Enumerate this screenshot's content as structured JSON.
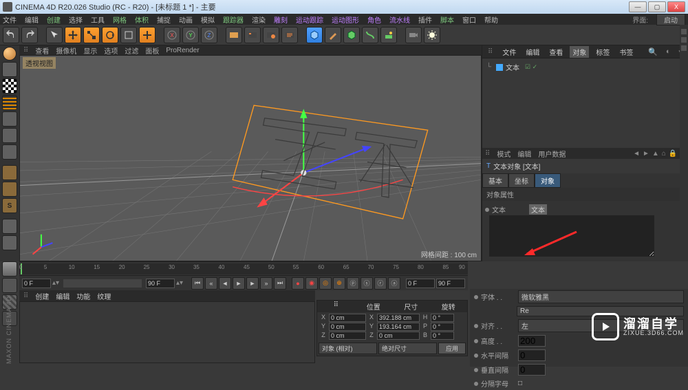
{
  "titlebar": {
    "title": "CINEMA 4D R20.026 Studio (RC - R20) - [未标题 1 *] - 主要"
  },
  "win": {
    "min": "—",
    "max": "▢",
    "close": "X"
  },
  "menu": {
    "items": [
      "文件",
      "编辑",
      "创建",
      "选择",
      "工具",
      "网格",
      "体积",
      "捕捉",
      "动画",
      "模拟",
      "跟踪器",
      "渲染",
      "雕刻",
      "运动跟踪",
      "运动图形",
      "角色",
      "流水线",
      "插件",
      "脚本",
      "窗口",
      "帮助"
    ],
    "layout_lbl": "界面:",
    "layout": "启动"
  },
  "vp_tabs": [
    "查看",
    "摄像机",
    "显示",
    "选项",
    "过滤",
    "面板",
    "ProRender"
  ],
  "viewport": {
    "label": "透视视图",
    "info": "网格间距 : 100 cm"
  },
  "objp": {
    "tabs": [
      "文件",
      "编辑",
      "查看",
      "对象",
      "标签",
      "书签"
    ],
    "item": "文本",
    "suffix": "☑ ✓"
  },
  "attr": {
    "tabs": [
      "模式",
      "编辑",
      "用户数据"
    ],
    "head": "文本对象 [文本]",
    "subtabs": [
      "基本",
      "坐标",
      "对象"
    ],
    "section": "对象属性",
    "text_lbl": "文本",
    "text_val": "文本",
    "font_lbl": "字体 . .",
    "font_val": "微软雅黑",
    "font_style": "Re",
    "align_lbl": "对齐 . .",
    "align_val": "左",
    "height_lbl": "高度 . .",
    "height_val": "200",
    "hspace_lbl": "水平间隔",
    "hspace_val": "0",
    "vspace_lbl": "垂直间隔",
    "vspace_val": "0",
    "sepchar_lbl": "分隔字母",
    "sepchar_val": "□"
  },
  "timeline": {
    "start": "0 F",
    "end": "90 F",
    "start2": "0 F",
    "end2": "90 F",
    "ticks": [
      0,
      5,
      10,
      15,
      20,
      25,
      30,
      35,
      40,
      45,
      50,
      55,
      60,
      65,
      70,
      75,
      80,
      85,
      90
    ]
  },
  "mat_tabs": [
    "创建",
    "编辑",
    "功能",
    "纹理"
  ],
  "coords": {
    "cols": [
      "位置",
      "尺寸",
      "旋转"
    ],
    "X_p": "0 cm",
    "X_s": "392.188 cm",
    "X_r": "0 °",
    "Y_p": "0 cm",
    "Y_s": "193.164 cm",
    "Y_r": "0 °",
    "Z_p": "0 cm",
    "Z_s": "0 cm",
    "Z_r": "0 °",
    "mode1": "对象 (相对)",
    "mode2": "绝对尺寸",
    "apply": "应用",
    "lx": "X",
    "ly": "Y",
    "lz": "Z",
    "lH": "H",
    "lP": "P",
    "lB": "B"
  },
  "watermark": {
    "cn": "溜溜自学",
    "en": "ZIXUE.3D66.COM"
  },
  "brand": "MAXON CINEMA 4D"
}
